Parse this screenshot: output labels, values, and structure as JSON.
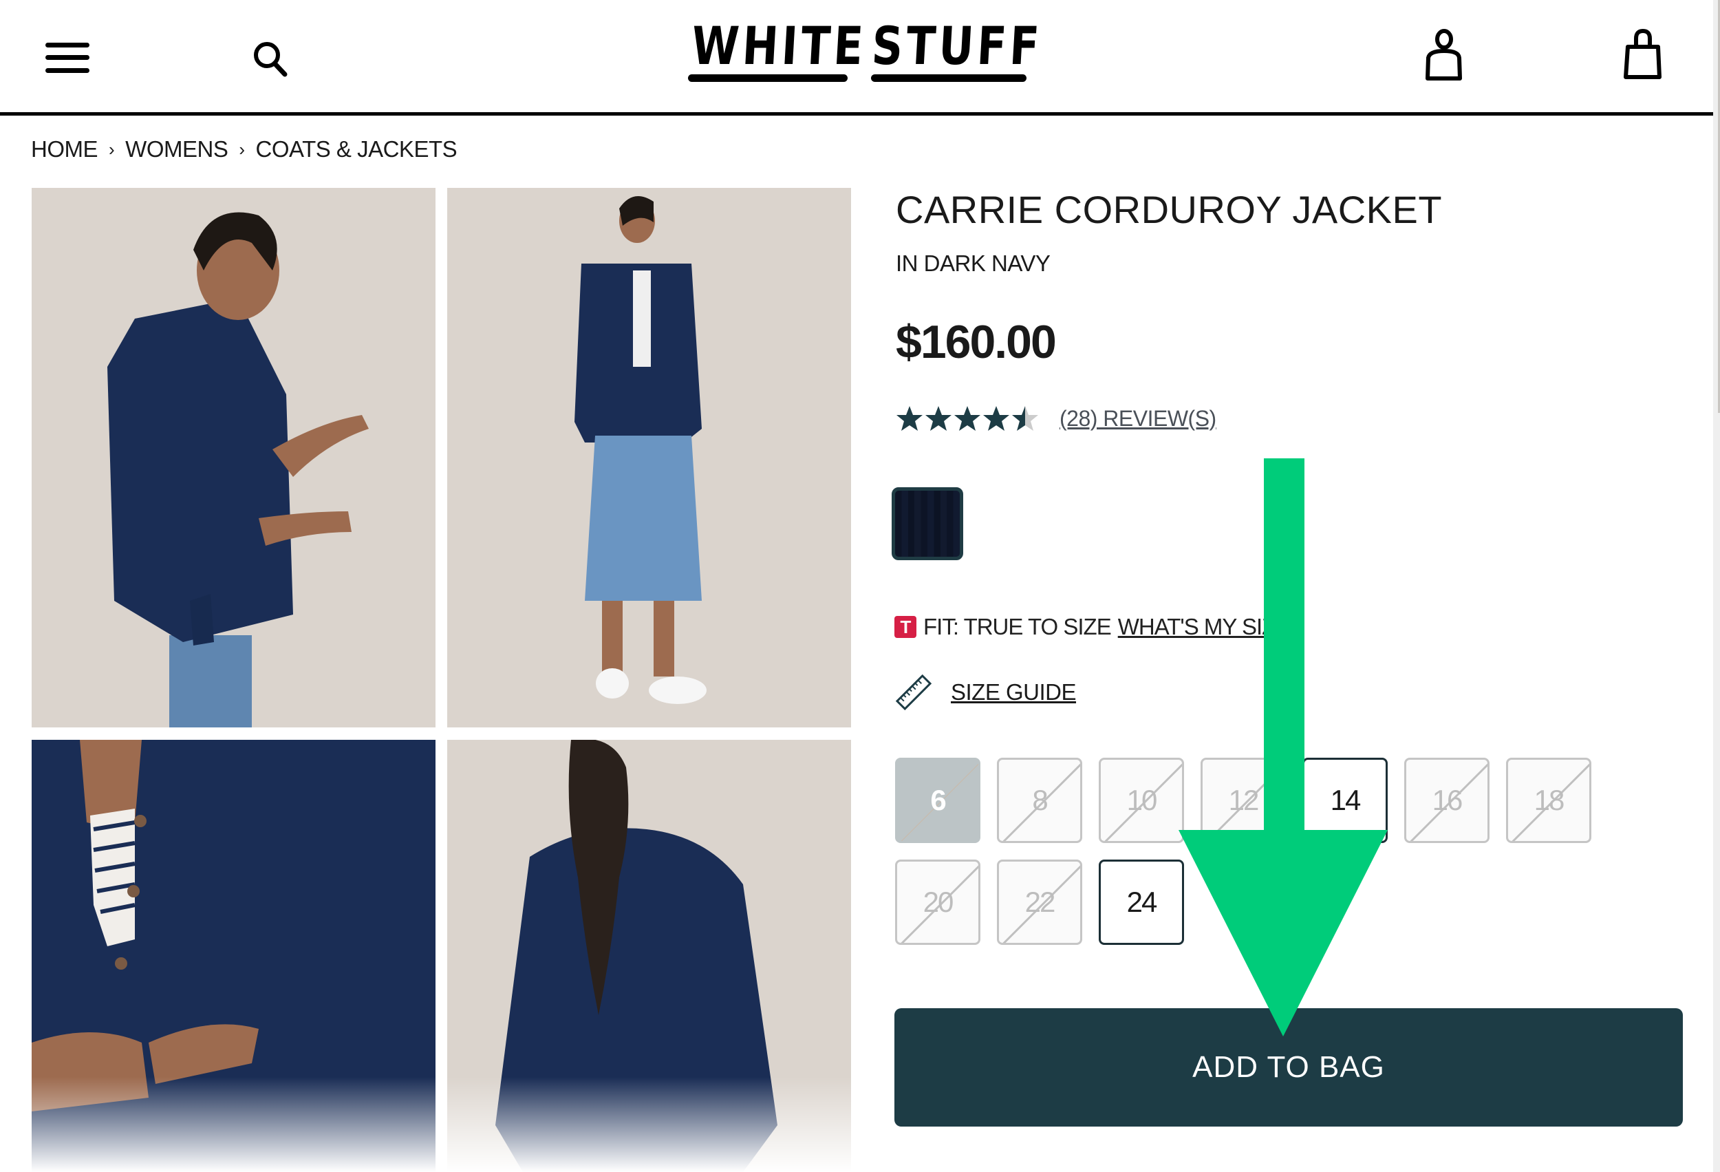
{
  "header": {
    "brand": {
      "word1": "WHITE",
      "word2": "STUFF"
    },
    "icons": [
      "menu-icon",
      "search-icon",
      "account-icon",
      "bag-icon"
    ]
  },
  "breadcrumb": [
    {
      "label": "HOME"
    },
    {
      "label": "WOMENS"
    },
    {
      "label": "COATS & JACKETS"
    }
  ],
  "breadcrumb_separator": "›",
  "gallery": [
    {
      "alt": "Model wearing dark navy corduroy jacket, side view"
    },
    {
      "alt": "Model wearing jacket with denim midi skirt, full length"
    },
    {
      "alt": "Close-up of jacket front buttons"
    },
    {
      "alt": "Back view of jacket"
    }
  ],
  "product": {
    "title": "CARRIE CORDUROY JACKET",
    "color_label": "IN DARK NAVY",
    "price": "$160.00",
    "rating": {
      "value": 4.5,
      "max": 5,
      "reviews_label": "(28) REVIEW(S)"
    },
    "swatches": [
      {
        "name": "Dark Navy",
        "color": "#0f1629",
        "selected": true
      }
    ],
    "fit": {
      "badge": "T",
      "text": "FIT: TRUE TO SIZE",
      "link": "WHAT'S MY SIZE?"
    },
    "size_guide_label": "SIZE GUIDE",
    "sizes": [
      {
        "label": "6",
        "state": "selected"
      },
      {
        "label": "8",
        "state": "unavailable"
      },
      {
        "label": "10",
        "state": "unavailable"
      },
      {
        "label": "12",
        "state": "unavailable"
      },
      {
        "label": "14",
        "state": "available"
      },
      {
        "label": "16",
        "state": "unavailable"
      },
      {
        "label": "18",
        "state": "unavailable"
      },
      {
        "label": "20",
        "state": "unavailable"
      },
      {
        "label": "22",
        "state": "unavailable"
      },
      {
        "label": "24",
        "state": "available"
      }
    ],
    "add_to_bag_label": "ADD TO BAG"
  },
  "colors": {
    "accent": "#1d3c45",
    "star_fill": "#1d3c45",
    "star_empty": "#cccccc",
    "fit_badge": "#d61f45",
    "annotation_arrow": "#00cc7a"
  }
}
